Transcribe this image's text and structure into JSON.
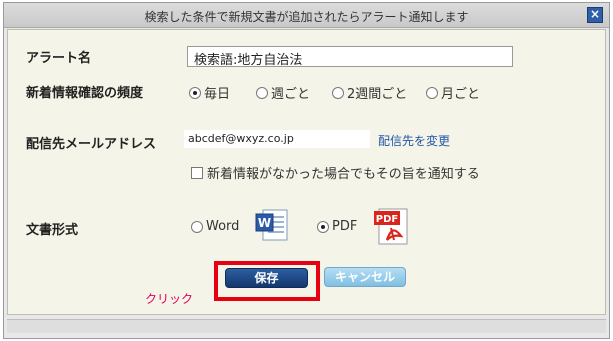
{
  "window": {
    "title": "検索した条件で新規文書が追加されたらアラート通知します",
    "close_glyph": "×"
  },
  "form": {
    "alert_name": {
      "label": "アラート名",
      "value": "検索語:地方自治法"
    },
    "frequency": {
      "label": "新着情報確認の頻度",
      "options": [
        {
          "label": "毎日",
          "checked": true
        },
        {
          "label": "週ごと",
          "checked": false
        },
        {
          "label": "2週間ごと",
          "checked": false
        },
        {
          "label": "月ごと",
          "checked": false
        }
      ]
    },
    "email": {
      "label": "配信先メールアドレス",
      "value": "abcdef@wxyz.co.jp",
      "change_link": "配信先を変更"
    },
    "notify_none": {
      "label": "新着情報がなかった場合でもその旨を通知する",
      "checked": false
    },
    "format": {
      "label": "文書形式",
      "options": [
        {
          "label": "Word",
          "checked": false,
          "icon": "word-icon"
        },
        {
          "label": "PDF",
          "checked": true,
          "icon": "pdf-icon"
        }
      ]
    }
  },
  "buttons": {
    "save": "保存",
    "cancel": "キャンセル"
  },
  "annotation": {
    "click_note": "クリック",
    "highlight_color": "#e60012"
  },
  "colors": {
    "save_button": "#1e4a8a",
    "cancel_button": "#9fd0ee",
    "link": "#2255aa"
  }
}
